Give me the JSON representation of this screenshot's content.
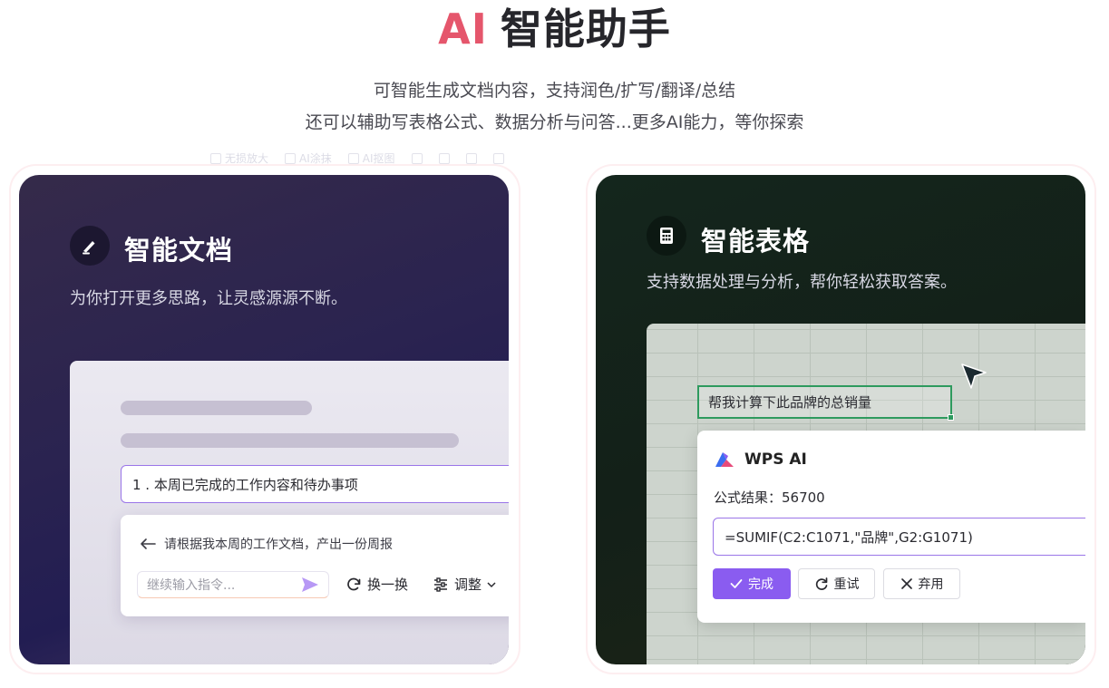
{
  "hero": {
    "title_accent": "AI",
    "title_main": "智能助手",
    "subtitle_line1": "可智能生成文档内容，支持润色/扩写/翻译/总结",
    "subtitle_line2": "还可以辅助写表格公式、数据分析与问答...更多AI能力，等你探索"
  },
  "ghost_toolbar": [
    "无损放大",
    "AI涂抹",
    "AI抠图"
  ],
  "doc_card": {
    "title": "智能文档",
    "description": "为你打开更多思路，让灵感源源不断。",
    "editor_line": "1 . 本周已完成的工作内容和待办事项",
    "prompt": "请根据我本周的工作文档，产出一份周报",
    "input_placeholder": "继续输入指令...",
    "action_swap": "换一换",
    "action_adjust": "调整",
    "icons": {
      "header": "pen-icon",
      "back": "arrow-left-icon",
      "send": "send-icon",
      "swap": "refresh-icon",
      "adjust": "sliders-icon",
      "dropdown": "chevron-down-icon"
    }
  },
  "sheet_card": {
    "title": "智能表格",
    "description": "支持数据处理与分析，帮你轻松获取答案。",
    "cell_text": "帮我计算下此品牌的总销量",
    "ai_name": "WPS AI",
    "result_label": "公式结果：56700",
    "formula": "=SUMIF(C2:C1071,\"品牌\",G2:G1071)",
    "btn_done": "完成",
    "btn_retry": "重试",
    "btn_discard": "弃用",
    "icons": {
      "header": "calculator-icon",
      "cursor": "pointer-cursor-icon",
      "logo": "wps-ai-logo-icon",
      "done": "check-icon",
      "retry": "retry-icon",
      "discard": "close-icon"
    }
  },
  "colors": {
    "accent_pink": "#e5566c",
    "accent_purple": "#8a5cf0",
    "selection_green": "#2e9a5e"
  }
}
